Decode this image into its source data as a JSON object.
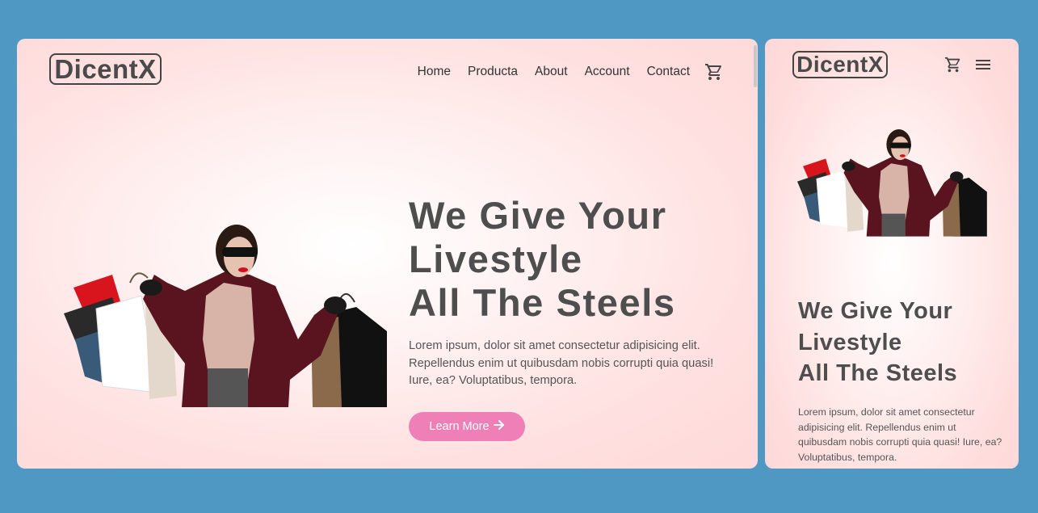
{
  "brand": {
    "logo_text": "DicentX"
  },
  "nav": {
    "items": [
      {
        "label": "Home"
      },
      {
        "label": "Producta"
      },
      {
        "label": "About"
      },
      {
        "label": "Account"
      },
      {
        "label": "Contact"
      }
    ],
    "cart_icon": "shopping-cart-icon",
    "menu_icon": "hamburger-menu-icon"
  },
  "hero": {
    "headline_lines": [
      "We Give Your",
      "Livestyle",
      "All The Steels"
    ],
    "description": "Lorem ipsum, dolor sit amet consectetur adipisicing elit. Repellendus enim ut quibusdam nobis corrupti quia quasi! Iure, ea? Voluptatibus, tempora.",
    "cta_label": "Learn More",
    "cta_icon": "arrow-right-icon",
    "image": "woman-with-shopping-bags"
  },
  "colors": {
    "background": "#5098c4",
    "panel": "#ffdede",
    "headline": "#4e4e4e",
    "accent": "#ef7fb7"
  }
}
